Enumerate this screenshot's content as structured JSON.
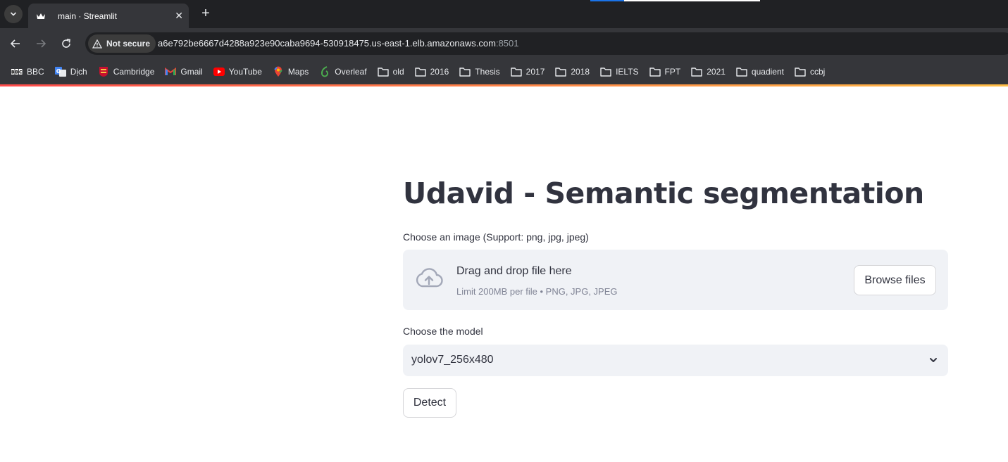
{
  "browser": {
    "tab": {
      "title": "main · Streamlit",
      "close_glyph": "✕"
    },
    "new_tab_glyph": "+",
    "security_label": "Not secure",
    "url_main": "a6e792be6667d4288a923e90caba9694-530918475.us-east-1.elb.amazonaws.com",
    "url_port": ":8501",
    "bookmarks": [
      {
        "label": "BBC",
        "icon": "bbc-icon"
      },
      {
        "label": "Dịch",
        "icon": "translate-icon"
      },
      {
        "label": "Cambridge",
        "icon": "cambridge-icon"
      },
      {
        "label": "Gmail",
        "icon": "gmail-icon"
      },
      {
        "label": "YouTube",
        "icon": "youtube-icon"
      },
      {
        "label": "Maps",
        "icon": "maps-icon"
      },
      {
        "label": "Overleaf",
        "icon": "overleaf-icon"
      },
      {
        "label": "old",
        "icon": "folder-icon"
      },
      {
        "label": "2016",
        "icon": "folder-icon"
      },
      {
        "label": "Thesis",
        "icon": "folder-icon"
      },
      {
        "label": "2017",
        "icon": "folder-icon"
      },
      {
        "label": "2018",
        "icon": "folder-icon"
      },
      {
        "label": "IELTS",
        "icon": "folder-icon"
      },
      {
        "label": "FPT",
        "icon": "folder-icon"
      },
      {
        "label": "2021",
        "icon": "folder-icon"
      },
      {
        "label": "quadient",
        "icon": "folder-icon"
      },
      {
        "label": "ccbj",
        "icon": "folder-icon"
      }
    ]
  },
  "app": {
    "title": "Udavid - Semantic segmentation",
    "uploader": {
      "label": "Choose an image (Support: png, jpg, jpeg)",
      "drop_text": "Drag and drop file here",
      "limit_text": "Limit 200MB per file • PNG, JPG, JPEG",
      "browse_label": "Browse files",
      "icon": "cloud-upload-icon"
    },
    "model_select": {
      "label": "Choose the model",
      "value": "yolov7_256x480",
      "icon": "chevron-down-icon"
    },
    "detect_label": "Detect"
  },
  "colors": {
    "text": "#31333f",
    "muted": "#808495",
    "widget_bg": "#f0f2f6",
    "accent_red": "#ff4b4b",
    "accent_yellow": "#ffbd45"
  }
}
